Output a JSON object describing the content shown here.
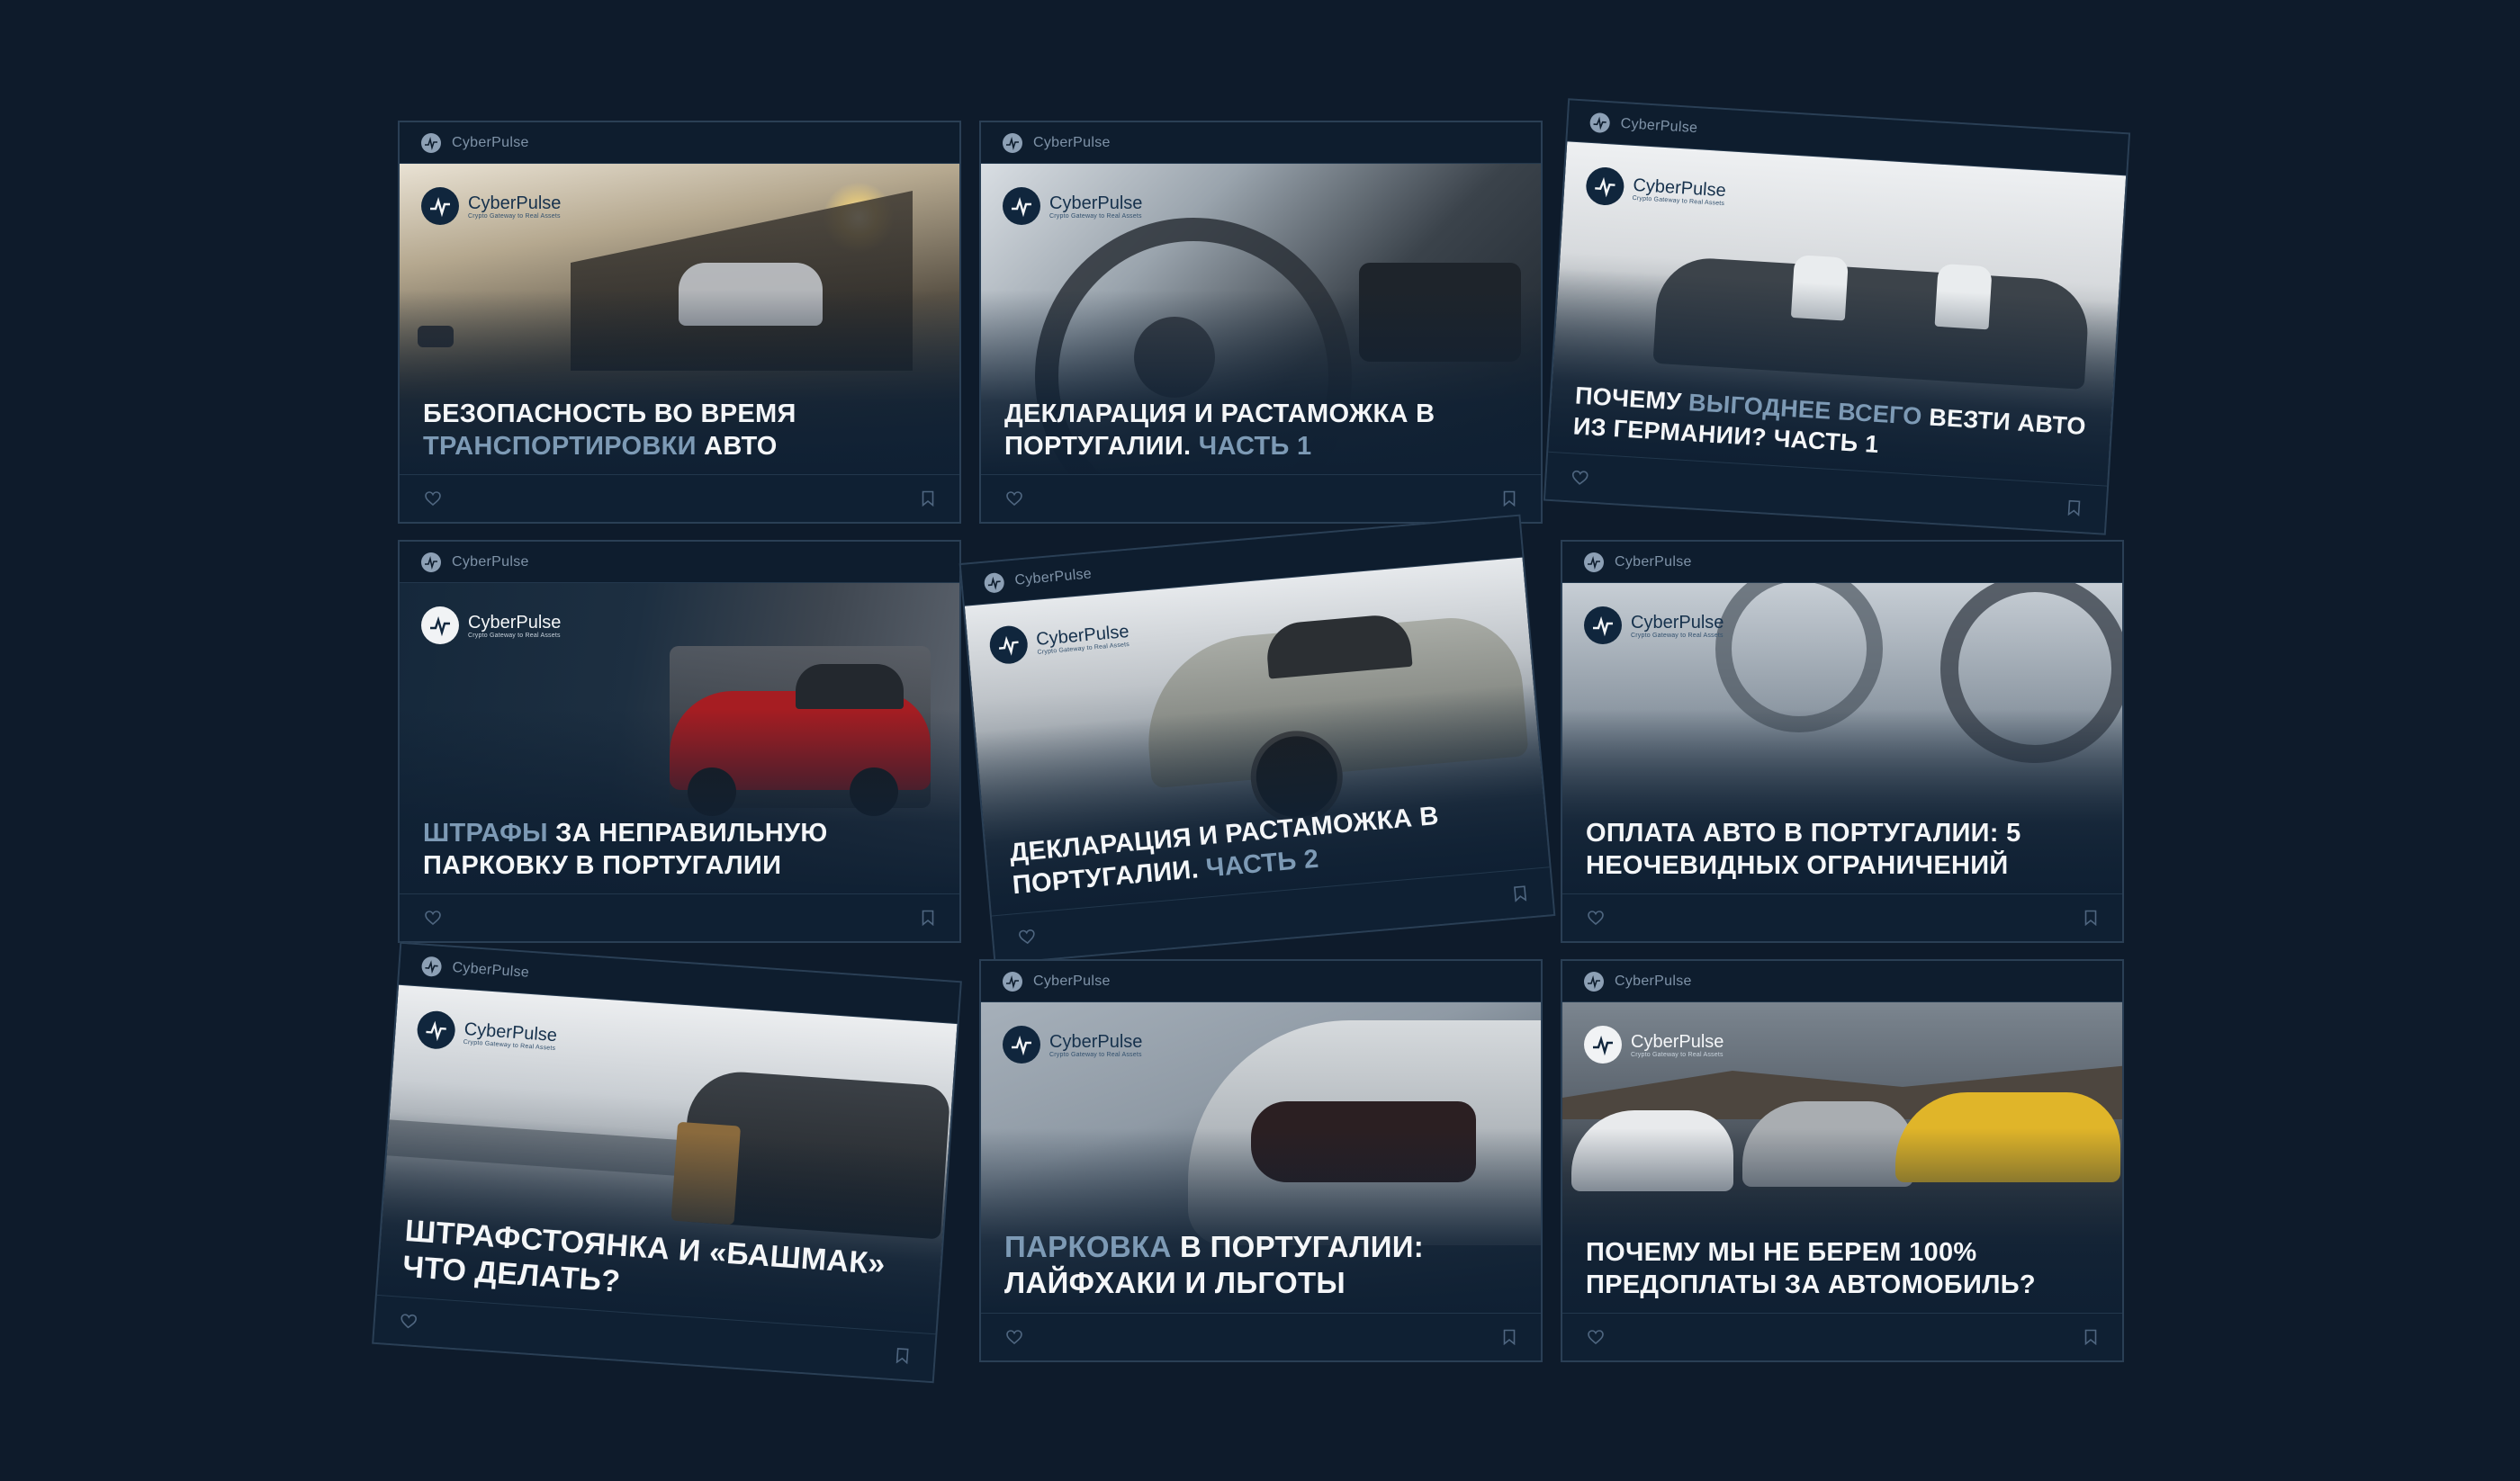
{
  "brand": {
    "name": "CyberPulse",
    "tagline": "Crypto Gateway to Real Assets"
  },
  "colors": {
    "background": "#0e1b2b",
    "card": "#0f2033",
    "accent_text": "#7d9ab5",
    "headline": "#f4f6f8"
  },
  "cards": [
    {
      "lead": "БЕЗОПАСНОСТЬ ВО ВРЕМЯ ",
      "accent": "ТРАНСПОРТИРОВКИ",
      "tail": " АВТО",
      "photo": "car-transporter-sunset"
    },
    {
      "lead": "ДЕКЛАРАЦИЯ И РАСТАМОЖКА В ПОРТУГАЛИИ. ",
      "accent": "ЧАСТЬ 1",
      "tail": "",
      "photo": "car-steering-wheel"
    },
    {
      "lead": "ПОЧЕМУ ",
      "accent": "ВЫГОДНЕЕ ВСЕГО",
      "tail": " ВЕЗТИ АВТО ИЗ ГЕРМАНИИ? ЧАСТЬ 1",
      "photo": "white-convertible"
    },
    {
      "lead": "",
      "accent": "ШТРАФЫ",
      "tail": " ЗА НЕПРАВИЛЬНУЮ ПАРКОВКУ В ПОРТУГАЛИИ",
      "photo": "red-tesla"
    },
    {
      "lead": "ДЕКЛАРАЦИЯ И РАСТАМОЖКА В ПОРТУГАЛИИ. ",
      "accent": "ЧАСТЬ 2",
      "tail": "",
      "photo": "grey-porsche"
    },
    {
      "lead": "ОПЛАТА АВТО В ПОРТУГАЛИИ: 5 НЕОЧЕВИДНЫХ ОГРАНИЧЕНИЙ",
      "accent": "",
      "tail": "",
      "photo": "car-wheels-fog"
    },
    {
      "lead": "ШТРАФСТОЯНКА И «БАШМАК» ЧТО ДЕЛАТЬ?",
      "accent": "",
      "tail": "",
      "photo": "tow-truck"
    },
    {
      "lead": "",
      "accent": "ПАРКОВКА",
      "tail": " В ПОРТУГАЛИИ: ЛАЙФХАКИ И ЛЬГОТЫ",
      "photo": "tesla-taillight"
    },
    {
      "lead": "ПОЧЕМУ МЫ НЕ БЕРЕМ 100% ПРЕДОПЛАТЫ ЗА АВТОМОБИЛЬ?",
      "accent": "",
      "tail": "",
      "photo": "porsche-lineup"
    }
  ]
}
